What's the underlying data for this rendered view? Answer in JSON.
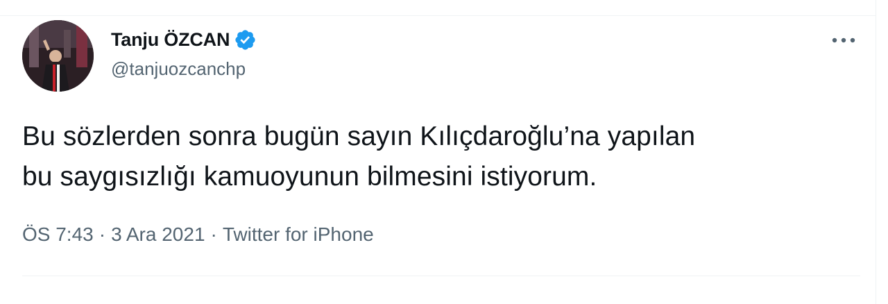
{
  "tweet": {
    "author": {
      "display_name": "Tanju ÖZCAN",
      "handle": "@tanjuozcanchp",
      "verified": true,
      "avatar_icon": "profile-photo"
    },
    "text_line_1": "Bu sözlerden sonra bugün sayın Kılıçdaroğlu’na yapılan",
    "text_line_2": "bu saygısızlığı kamuoyunun bilmesini istiyorum.",
    "meta": {
      "time": "ÖS 7:43",
      "separator": "·",
      "date": "3 Ara 2021",
      "source": "Twitter for iPhone"
    },
    "more_icon": "more-horizontal-icon",
    "colors": {
      "text": "#0f1419",
      "secondary": "#536471",
      "verified": "#1d9bf0",
      "divider": "#eff3f4"
    }
  }
}
